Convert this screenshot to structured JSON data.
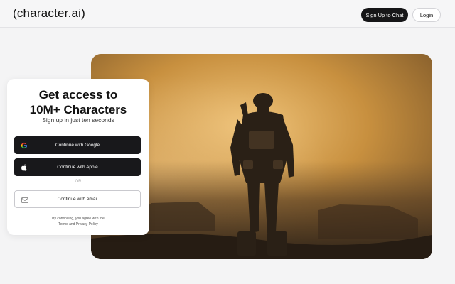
{
  "header": {
    "logo": "(character.ai)",
    "signup_label": "Sign Up to Chat",
    "login_label": "Login"
  },
  "signup_card": {
    "title_line1": "Get access to",
    "title_line2": "10M+ Characters",
    "subtitle": "Sign up in just ten seconds",
    "google_label": "Continue with Google",
    "apple_label": "Continue with Apple",
    "or_label": "OR",
    "email_label": "Continue with email",
    "terms_line1": "By continuing, you agree with the",
    "terms_line2": "Terms and Privacy Policy"
  },
  "hero": {
    "image": "soldier-in-dusty-battlefield",
    "palette": [
      "#d8a95c",
      "#a9773a",
      "#5a4128",
      "#2c2219"
    ]
  },
  "icons": [
    "google-icon",
    "apple-icon",
    "mail-icon"
  ]
}
